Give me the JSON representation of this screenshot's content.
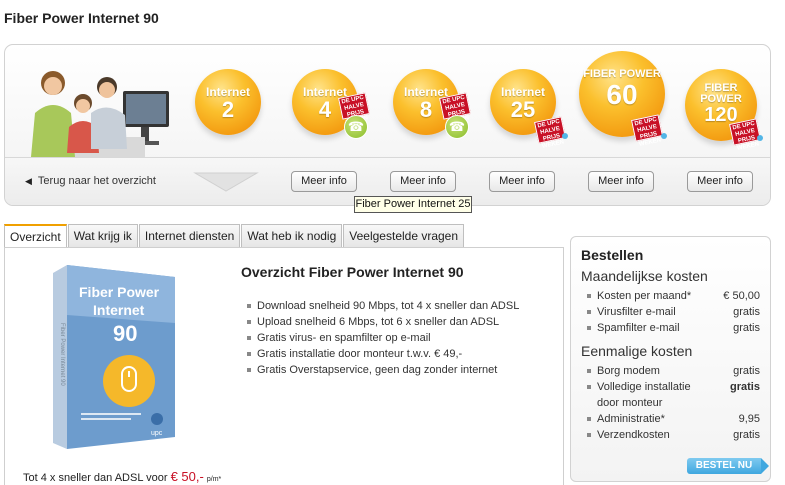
{
  "page": {
    "title": "Fiber Power Internet 90"
  },
  "carousel": {
    "products": [
      {
        "line1": "Internet",
        "line2": "2",
        "promo": false,
        "phone": false
      },
      {
        "line1": "Internet",
        "line2": "4",
        "promo": true,
        "phone": true
      },
      {
        "line1": "Internet",
        "line2": "8",
        "promo": true,
        "phone": true
      },
      {
        "line1": "Internet",
        "line2": "25",
        "promo": true,
        "phone": false
      },
      {
        "line1": "FIBER POWER",
        "line2": "60",
        "promo": true,
        "phone": false
      },
      {
        "line1": "FIBER POWER",
        "line2": "120",
        "promo": true,
        "phone": false
      }
    ],
    "promo_text": "DE UPC HALVE PRIJS WEKEN",
    "back_link": "Terug naar het overzicht",
    "meer_info": "Meer info",
    "tooltip": "Fiber Power Internet 25"
  },
  "tabs": [
    {
      "label": "Overzicht",
      "active": true
    },
    {
      "label": "Wat krijg ik",
      "active": false
    },
    {
      "label": "Internet diensten",
      "active": false
    },
    {
      "label": "Wat heb ik nodig",
      "active": false
    },
    {
      "label": "Veelgestelde vragen",
      "active": false
    }
  ],
  "overview": {
    "title": "Overzicht Fiber Power Internet 90",
    "box": {
      "line1": "Fiber Power",
      "line2": "Internet",
      "line3": "90",
      "spine": "Fiber Power Internet 90",
      "brand": "upc"
    },
    "caption_prefix": "Tot 4 x sneller dan ADSL voor ",
    "caption_price": "€ 50,-",
    "caption_suffix": "p/m*",
    "features": [
      "Download snelheid 90 Mbps, tot 4 x sneller dan ADSL",
      "Upload snelheid 6 Mbps, tot 6 x sneller dan ADSL",
      "Gratis virus- en spamfilter op e-mail",
      "Gratis installatie door monteur t.w.v. € 49,-",
      "Gratis Overstapservice, geen dag zonder internet"
    ]
  },
  "order": {
    "title": "Bestellen",
    "monthly_title": "Maandelijkse kosten",
    "monthly": [
      {
        "label": "Kosten per maand*",
        "value": "€ 50,00",
        "bold": false
      },
      {
        "label": "Virusfilter e-mail",
        "value": "gratis",
        "bold": false
      },
      {
        "label": "Spamfilter e-mail",
        "value": "gratis",
        "bold": false
      }
    ],
    "once_title": "Eenmalige kosten",
    "once": [
      {
        "label": "Borg modem",
        "value": "gratis",
        "bold": false
      },
      {
        "label": "Volledige installatie",
        "label2": "door monteur",
        "value": "gratis",
        "bold": true
      },
      {
        "label": "Administratie*",
        "value": "9,95",
        "bold": false
      },
      {
        "label": "Verzendkosten",
        "value": "gratis",
        "bold": false
      }
    ],
    "button": "BESTEL NU"
  },
  "colors": {
    "accent_orange": "#f39a10",
    "promo_red": "#c81126",
    "button_blue": "#3fa7df",
    "phone_green": "#8bbd2a"
  }
}
